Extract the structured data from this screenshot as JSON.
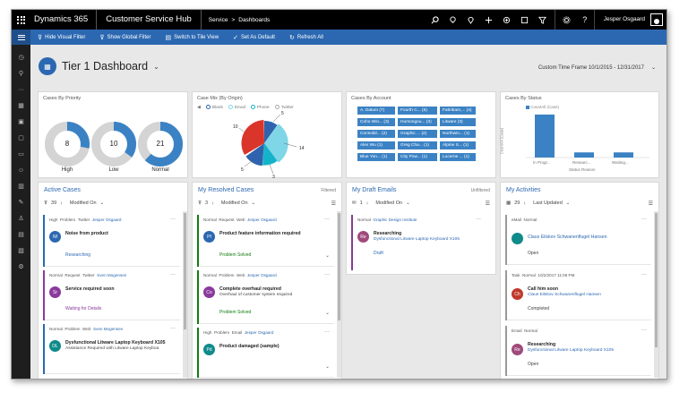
{
  "topnav": {
    "brand": "Dynamics 365",
    "app": "Customer Service Hub",
    "crumb_1": "Service",
    "crumb_sep": ">",
    "crumb_2": "Dashboards",
    "user": "Jesper Osgaard"
  },
  "cmdbar": {
    "hide_visual_filter": "Hide Visual Filter",
    "show_global_filter": "Show Global Filter",
    "switch_tile_view": "Switch to Tile View",
    "set_default": "Set As Default",
    "refresh_all": "Refresh All"
  },
  "dashboard": {
    "title": "Tier 1 Dashboard",
    "time_frame": "Custom Time Frame 10/1/2015 - 12/31/2017"
  },
  "charts": {
    "priority": {
      "title": "Cases By Priority",
      "items": [
        {
          "label": "High",
          "value": "8",
          "fraction": 0.28
        },
        {
          "label": "Low",
          "value": "10",
          "fraction": 0.35
        },
        {
          "label": "Normal",
          "value": "21",
          "fraction": 0.62
        }
      ]
    },
    "origin": {
      "title": "Case Mix (By Origin)",
      "legend": [
        "Blank",
        "Email",
        "Phone",
        "Twitter"
      ],
      "values": [
        "5",
        "14",
        "3",
        "5",
        "10"
      ]
    },
    "account": {
      "title": "Cases By Account",
      "tags": [
        "A. Datum (7)",
        "Fourth C... (5)",
        "Fabrikam,... (4)",
        "Coho Win... (3)",
        "Humongou... (3)",
        "Litware (3)",
        "Consolid... (2)",
        "Graphic ... (2)",
        "Northwin... (1)",
        "Alex Wu (1)",
        "Greg Cha... (1)",
        "Alpine S... (1)",
        "Blue Yon... (1)",
        "City Pow... (1)",
        "Lucerne ... (1)"
      ]
    },
    "status": {
      "title": "Cases By Status",
      "legend": "CountAll (Case)",
      "ylabel": "CountAll (Case)",
      "xlabel": "Status Reason",
      "categories": [
        "In Progr...",
        "Researc...",
        "Waiting..."
      ],
      "values": [
        1.0,
        0.12,
        0.12
      ]
    }
  },
  "streams": {
    "active": {
      "title": "Active Cases",
      "count": "39",
      "sort": "Modified On",
      "cards": [
        {
          "meta1": "High",
          "meta2": "Problem",
          "meta3": "Twitter",
          "owner": "Jesper Osgaard",
          "initials": "Nf",
          "title": "Noise from product",
          "sub": "",
          "status": "Researching"
        },
        {
          "meta1": "Normal",
          "meta2": "Request",
          "meta3": "Twitter",
          "owner": "Sven Mogensen",
          "initials": "Sr",
          "title": "Service required soon",
          "sub": "",
          "status": "Waiting for Details"
        },
        {
          "meta1": "Normal",
          "meta2": "Problem",
          "meta3": "Web",
          "owner": "Sven Mogensen",
          "initials": "DL",
          "title": "Dysfunctional Litware Laptop Keyboard X105",
          "sub": "Assistance Required with Litware Laptop Keyboa",
          "status": ""
        }
      ]
    },
    "resolved": {
      "title": "My Resolved Cases",
      "state": "Filtered",
      "count": "3",
      "sort": "Modified On",
      "cards": [
        {
          "meta1": "Normal",
          "meta2": "Request",
          "meta3": "Web",
          "owner": "Jesper Osgaard",
          "initials": "Pf",
          "title": "Product feature information required",
          "sub": "",
          "status": "Problem Solved"
        },
        {
          "meta1": "Normal",
          "meta2": "Problem",
          "meta3": "Web",
          "owner": "Jesper Osgaard",
          "initials": "Co",
          "title": "Complete overhaul required",
          "sub": "Overhaul of customer system required",
          "status": "Problem Solved"
        },
        {
          "meta1": "High",
          "meta2": "Problem",
          "meta3": "Email",
          "owner": "Jesper Osgaard",
          "initials": "Pd",
          "title": "Product damaged (sample)",
          "sub": "",
          "status": ""
        }
      ]
    },
    "drafts": {
      "title": "My Draft Emails",
      "state": "Unfiltered",
      "count": "1",
      "sort": "Modified On",
      "cards": [
        {
          "meta1": "Normal",
          "owner": "Graphic Design Institute",
          "initials": "Re",
          "title": "Researching",
          "sub": "Dysfunctional Litware Laptop Keyboard X105",
          "status": "Draft"
        }
      ]
    },
    "activities": {
      "title": "My Activities",
      "count": "29",
      "sort": "Last Updated",
      "cards": [
        {
          "meta1": "eMail",
          "meta2": "Normal",
          "meta3": "",
          "initials": "",
          "title": "Claus Eilskov Schwanenflugel Hansen",
          "sub": "",
          "status": "Open"
        },
        {
          "meta1": "Task",
          "meta2": "Normal",
          "meta3": "10/2/2017 11:06 PM",
          "initials": "Ch",
          "title": "Call him soon",
          "sub": "Claus Eilskov Schwanenflugel Hansen",
          "status": "Completed"
        },
        {
          "meta1": "Email",
          "meta2": "Normal",
          "meta3": "",
          "initials": "Re",
          "title": "Researching",
          "sub": "Dysfunctional Litware Laptop Keyboard X105",
          "status": "Open"
        }
      ]
    }
  },
  "colors": {
    "accent": "#2c68b1",
    "donut_fill": "#3b82c4",
    "donut_bg": "#d4d4d4",
    "pie_blue": "#2f63ad",
    "pie_cyan": "#7fd6e6",
    "pie_teal": "#15b3c9",
    "pie_red": "#d9352a",
    "green_status": "#107c10",
    "purple_status": "#8a3a9c"
  }
}
